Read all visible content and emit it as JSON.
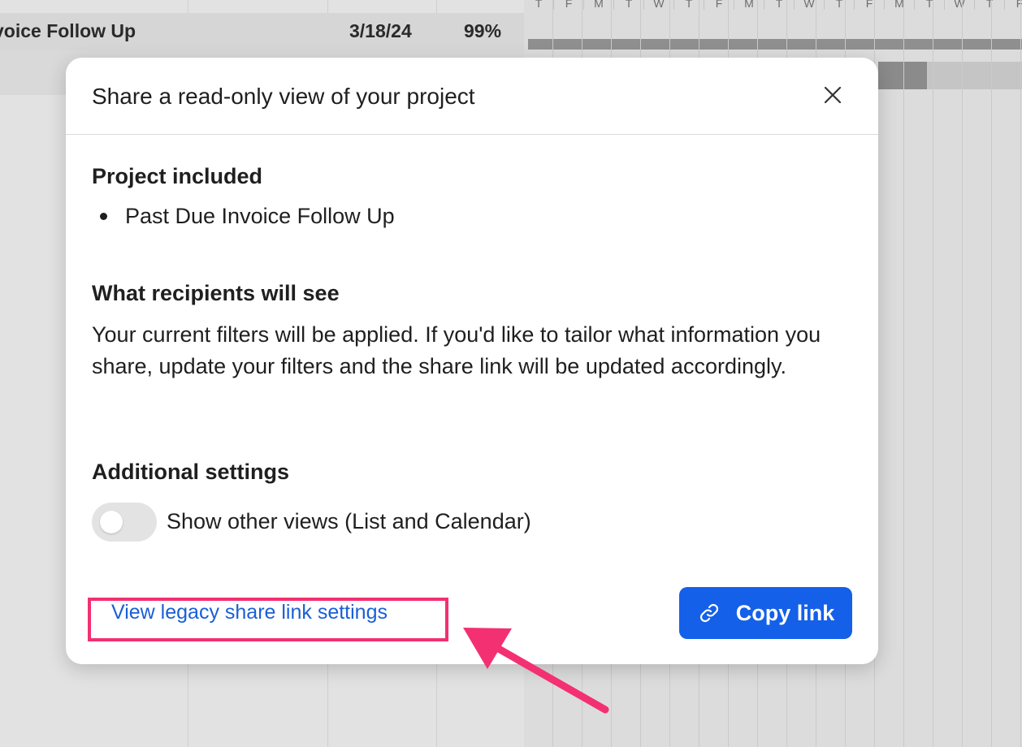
{
  "background": {
    "task_row": {
      "task_name": "voice Follow Up",
      "date": "3/18/24",
      "percent": "99%"
    },
    "day_headers": [
      "T",
      "F",
      "M",
      "T",
      "W",
      "T",
      "F",
      "M",
      "T",
      "W",
      "T",
      "F",
      "M",
      "T",
      "W",
      "T",
      "F"
    ]
  },
  "modal": {
    "title": "Share a read-only view of your project",
    "close_icon": "close-icon",
    "project_section": {
      "heading": "Project included",
      "items": [
        "Past Due Invoice Follow Up"
      ]
    },
    "recipients_section": {
      "heading": "What recipients will see",
      "description": "Your current filters will be applied. If you'd like to tailor what information you share, update your filters and the share link will be updated accordingly."
    },
    "settings_section": {
      "heading": "Additional settings",
      "toggle_label": "Show other views (List and Calendar)",
      "toggle_on": false
    },
    "legacy_link": "View legacy share link settings",
    "copy_button": "Copy link"
  },
  "colors": {
    "primary": "#1560e8",
    "link": "#1a5fd6",
    "annotation": "#f33071"
  }
}
